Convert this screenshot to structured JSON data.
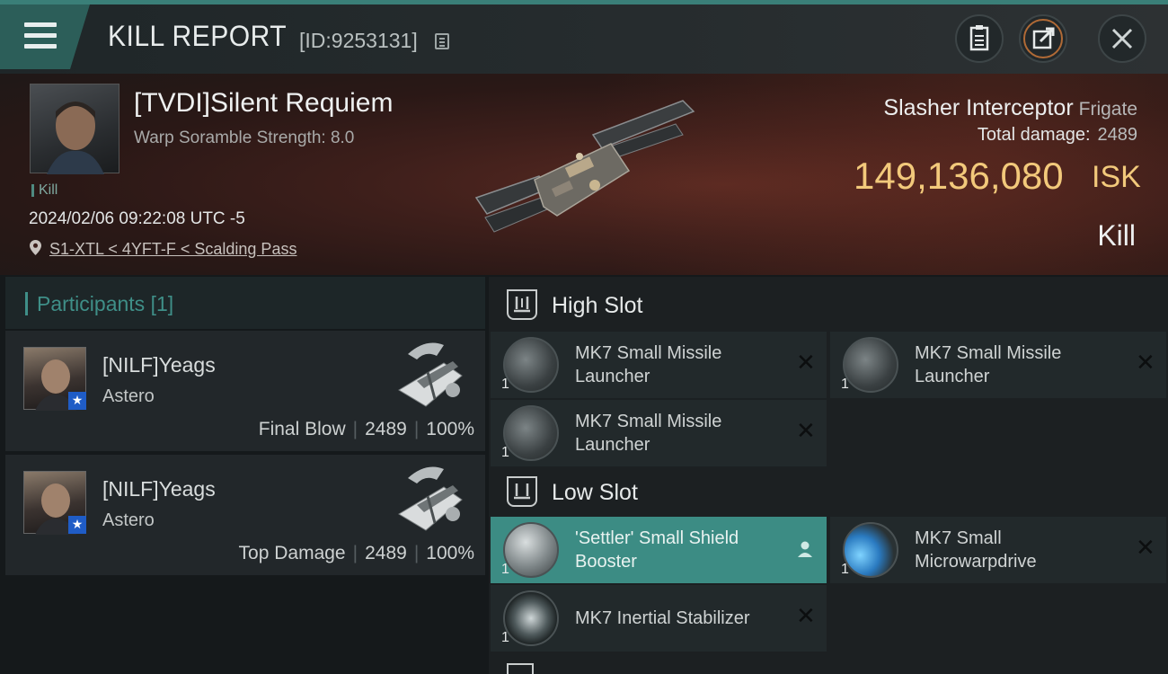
{
  "header": {
    "title": "KILL REPORT",
    "report_id": "[ID:9253131]",
    "buttons": [
      "clipboard-icon",
      "share-icon",
      "close-icon"
    ]
  },
  "victim": {
    "name": "[TVDI]Silent Requiem",
    "warp_scramble": "Warp Soramble Strength: 8.0",
    "tag": "Kill",
    "datetime": "2024/02/06 09:22:08 UTC -5",
    "location": "S1-XTL < 4YFT-F < Scalding Pass",
    "ship_name": "Slasher Interceptor",
    "ship_class": "Frigate",
    "total_damage_label": "Total damage:",
    "total_damage_value": "2489",
    "isk_value": "149,136,080",
    "isk_unit": "ISK",
    "result_label": "Kill"
  },
  "participants": {
    "title": "Participants",
    "count": "[1]",
    "items": [
      {
        "name": "[NILF]Yeags",
        "ship": "Astero",
        "label": "Final Blow",
        "damage": "2489",
        "percent": "100%"
      },
      {
        "name": "[NILF]Yeags",
        "ship": "Astero",
        "label": "Top Damage",
        "damage": "2489",
        "percent": "100%"
      }
    ]
  },
  "slots": {
    "high": {
      "title": "High Slot",
      "modules": [
        {
          "name": "MK7 Small Missile Launcher",
          "qty": "1"
        },
        {
          "name": "MK7 Small Missile Launcher",
          "qty": "1"
        },
        {
          "name": "MK7 Small Missile Launcher",
          "qty": "1"
        }
      ]
    },
    "low": {
      "title": "Low Slot",
      "modules": [
        {
          "name": "'Settler' Small Shield Booster",
          "qty": "1",
          "status": "dropped"
        },
        {
          "name": "MK7 Small Microwarpdrive",
          "qty": "1",
          "status": "destroyed"
        },
        {
          "name": "MK7 Inertial Stabilizer",
          "qty": "1",
          "status": "destroyed"
        }
      ]
    }
  },
  "colors": {
    "accent": "#3c8c84",
    "isk": "#f2c97b",
    "banner": "#3e1f1b"
  }
}
